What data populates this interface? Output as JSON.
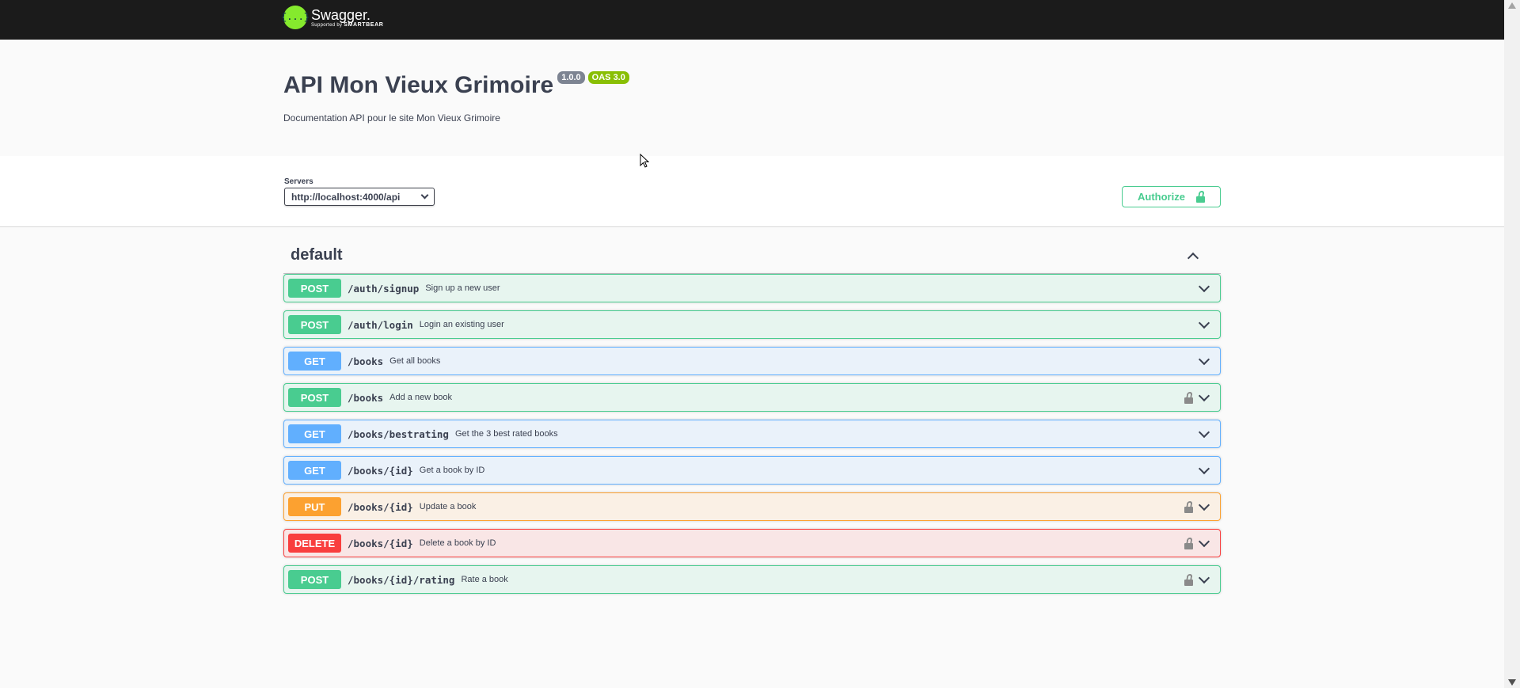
{
  "topbar": {
    "logo_text": "Swagger.",
    "logo_sub_prefix": "Supported by",
    "logo_sub_brand": "SMARTBEAR",
    "logo_icon": "{...}"
  },
  "info": {
    "title": "API Mon Vieux Grimoire",
    "version": "1.0.0",
    "oas": "OAS 3.0",
    "description": "Documentation API pour le site Mon Vieux Grimoire"
  },
  "scheme": {
    "servers_label": "Servers",
    "selected_server": "http://localhost:4000/api",
    "authorize_label": "Authorize"
  },
  "tag": {
    "name": "default",
    "operations": [
      {
        "method": "POST",
        "path": "/auth/signup",
        "summary": "Sign up a new user",
        "locked": false,
        "style": "post"
      },
      {
        "method": "POST",
        "path": "/auth/login",
        "summary": "Login an existing user",
        "locked": false,
        "style": "post"
      },
      {
        "method": "GET",
        "path": "/books",
        "summary": "Get all books",
        "locked": false,
        "style": "get"
      },
      {
        "method": "POST",
        "path": "/books",
        "summary": "Add a new book",
        "locked": true,
        "style": "post"
      },
      {
        "method": "GET",
        "path": "/books/bestrating",
        "summary": "Get the 3 best rated books",
        "locked": false,
        "style": "get"
      },
      {
        "method": "GET",
        "path": "/books/{id}",
        "summary": "Get a book by ID",
        "locked": false,
        "style": "get"
      },
      {
        "method": "PUT",
        "path": "/books/{id}",
        "summary": "Update a book",
        "locked": true,
        "style": "put"
      },
      {
        "method": "DELETE",
        "path": "/books/{id}",
        "summary": "Delete a book by ID",
        "locked": true,
        "style": "delete"
      },
      {
        "method": "POST",
        "path": "/books/{id}/rating",
        "summary": "Rate a book",
        "locked": true,
        "style": "post"
      }
    ]
  },
  "colors": {
    "post": "#49cc90",
    "get": "#61affe",
    "put": "#fca130",
    "delete": "#f93e3e",
    "topbar": "#1b1b1b",
    "logo_green": "#85ea2d"
  }
}
